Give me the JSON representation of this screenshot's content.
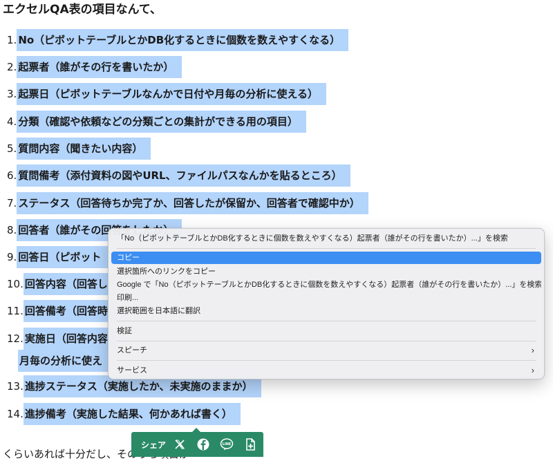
{
  "heading": "エクセルQA表の項目なんて、",
  "list": [
    {
      "num": "1.",
      "text": "No（ピボットテーブルとかDB化するときに個数を数えやすくなる）"
    },
    {
      "num": "2.",
      "text": "起票者（誰がその行を書いたか）"
    },
    {
      "num": "3.",
      "text": "起票日（ピボットテーブルなんかで日付や月毎の分析に使える）"
    },
    {
      "num": "4.",
      "text": "分類（確認や依頼などの分類ごとの集計ができる用の項目）"
    },
    {
      "num": "5.",
      "text": "質問内容（聞きたい内容）"
    },
    {
      "num": "6.",
      "text": "質問備考（添付資料の図やURL、ファイルパスなんかを貼るところ）"
    },
    {
      "num": "7.",
      "text": "ステータス（回答待ちか完了か、回答したが保留か、回答者で確認中か）"
    },
    {
      "num": "8.",
      "text": "回答者（誰がその回答をしたか）"
    },
    {
      "num": "9.",
      "text": "回答日（ピボット"
    },
    {
      "num": "10.",
      "text": "回答内容（回答し"
    },
    {
      "num": "11.",
      "text": "回答備考（回答時"
    },
    {
      "num": "12.",
      "text": "実施日（回答内容",
      "cont": "月毎の分析に使え"
    },
    {
      "num": "13.",
      "text": "進捗ステータス（実施したか、未実施のままか）"
    },
    {
      "num": "14.",
      "text": "進捗備考（実施した結果、何かあれば書く）"
    }
  ],
  "bottom_text": "くらいあれば十分だし、そのうち項目が・・・",
  "context_menu": {
    "search_label": "「No（ピボットテーブルとかDB化するときに個数を数えやすくなる）起票者（誰がその行を書いたか）...」を検索",
    "copy": "コピー",
    "copy_link": "選択箇所へのリンクをコピー",
    "google_search": "Google で「No（ピボットテーブルとかDB化するときに個数を数えやすくなる）起票者（誰がその行を書いたか）...」を検索",
    "print": "印刷...",
    "translate": "選択範囲を日本語に翻訳",
    "inspect": "検証",
    "speech": "スピーチ",
    "services": "サービス"
  },
  "share_bar": {
    "label": "シェア",
    "icons": [
      "x-icon",
      "facebook-icon",
      "line-icon",
      "add-note-icon"
    ]
  },
  "colors": {
    "selection": "#b3d4fb",
    "menu_highlight": "#3d8ef2",
    "share_bar": "#2a8a66"
  }
}
